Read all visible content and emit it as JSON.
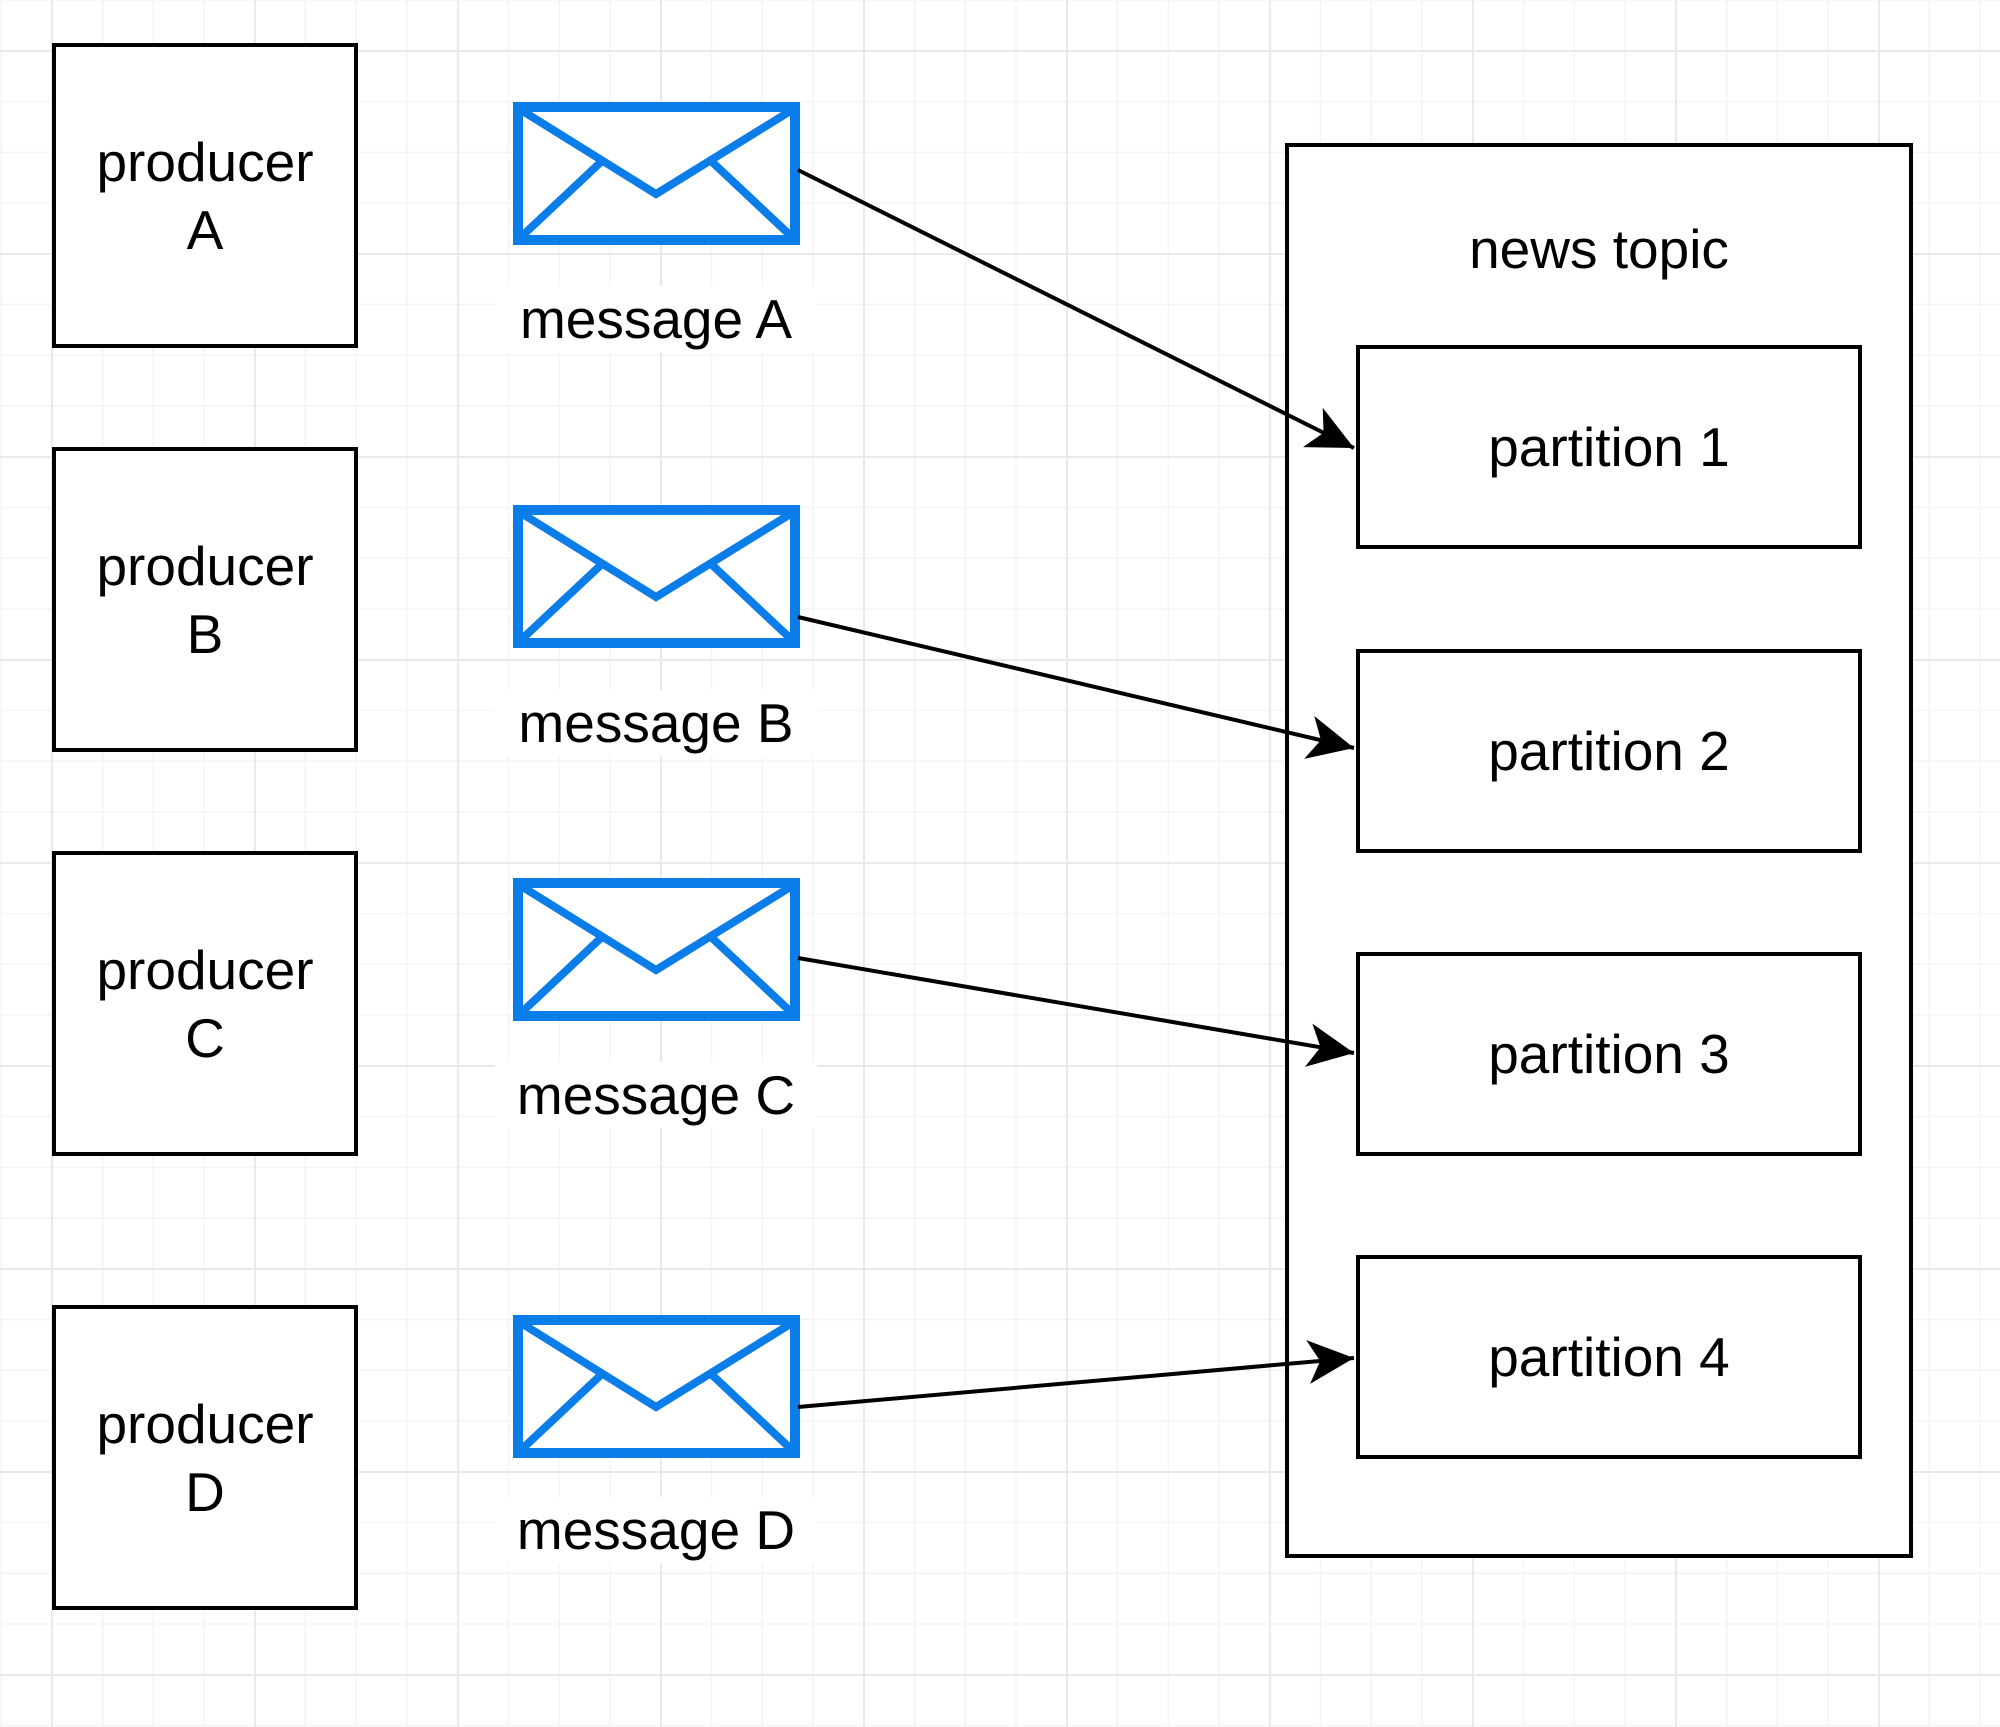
{
  "diagram": {
    "accent_color": "#0b7de8",
    "producers": [
      {
        "line1": "producer",
        "line2": "A"
      },
      {
        "line1": "producer",
        "line2": "B"
      },
      {
        "line1": "producer",
        "line2": "C"
      },
      {
        "line1": "producer",
        "line2": "D"
      }
    ],
    "messages": [
      {
        "label": "message A",
        "icon": "envelope-icon",
        "target": "partition 1"
      },
      {
        "label": "message B",
        "icon": "envelope-icon",
        "target": "partition 2"
      },
      {
        "label": "message C",
        "icon": "envelope-icon",
        "target": "partition 3"
      },
      {
        "label": "message D",
        "icon": "envelope-icon",
        "target": "partition 4"
      }
    ],
    "topic": {
      "title": "news topic",
      "partitions": [
        "partition 1",
        "partition 2",
        "partition 3",
        "partition 4"
      ]
    }
  }
}
